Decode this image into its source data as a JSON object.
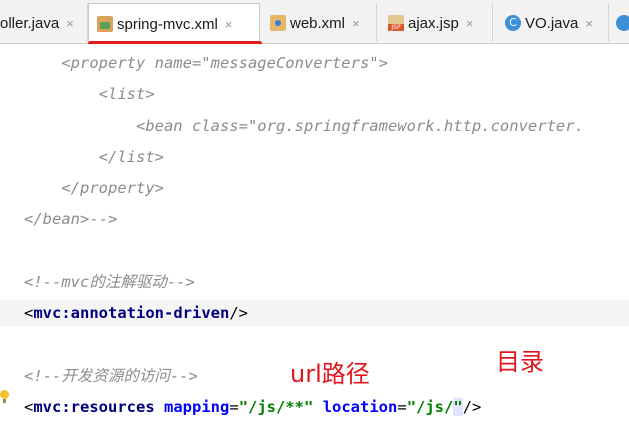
{
  "tabs": [
    {
      "label": "oller.java",
      "icon": "java-class-icon",
      "active": false
    },
    {
      "label": "spring-mvc.xml",
      "icon": "xml-file-icon",
      "active": true
    },
    {
      "label": "web.xml",
      "icon": "web-xml-icon",
      "active": false
    },
    {
      "label": "ajax.jsp",
      "icon": "jsp-file-icon",
      "active": false
    },
    {
      "label": "VO.java",
      "icon": "java-class-icon",
      "active": false
    }
  ],
  "class_icon_glyph": "C",
  "close_glyph": "×",
  "code": {
    "l1": {
      "indent": "    ",
      "text": "<property name=\"messageConverters\">"
    },
    "l2": {
      "indent": "        ",
      "text": "<list>"
    },
    "l3": {
      "indent": "            ",
      "text": "<bean class=\"org.springframework.http.converter."
    },
    "l4": {
      "indent": "        ",
      "text": "</list>"
    },
    "l5": {
      "indent": "    ",
      "text": "</property>"
    },
    "l6": {
      "indent": "",
      "text": "</bean>-->"
    },
    "l7": {
      "text": "<!--mvc的注解驱动-->"
    },
    "l8": {
      "open": "<",
      "tag": "mvc:annotation-driven",
      "close": "/>"
    },
    "l9": {
      "text": "<!--开发资源的访问-->"
    },
    "l10": {
      "open": "<",
      "tag": "mvc:resources",
      "attr1": "mapping",
      "eq1": "=",
      "val1": "\"/js/**\"",
      "attr2": "location",
      "eq2": "=",
      "val2a": "\"/js/",
      "val2b": "\"",
      "close": "/>"
    }
  },
  "annotations": {
    "url": "url路径",
    "dir": "目录"
  },
  "colors": {
    "annotation": "#e0161e",
    "underline": "#e31a1a",
    "tag": "#000080",
    "attr": "#0000ff",
    "string": "#008000",
    "comment": "#8c8c8c"
  }
}
